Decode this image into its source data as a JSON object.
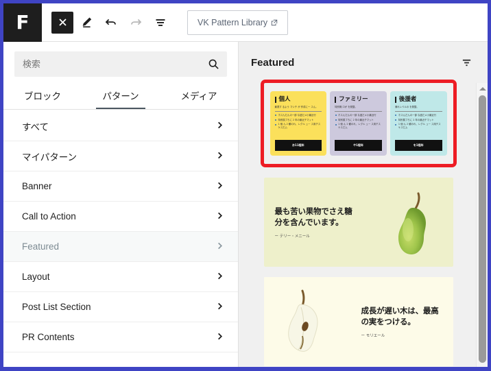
{
  "window": {
    "accent_border_color": "#3f44c4",
    "logo_letter": "F"
  },
  "toolbar": {
    "close_label": "×",
    "icons": [
      {
        "name": "close-icon",
        "label": "×"
      },
      {
        "name": "edit-pencil-icon",
        "label": "Edit"
      },
      {
        "name": "undo-icon",
        "label": "Undo"
      },
      {
        "name": "redo-icon",
        "label": "Redo"
      },
      {
        "name": "document-overview-icon",
        "label": "Document Overview"
      }
    ],
    "vk_button_label": "VK Pattern Library",
    "vk_button_external_glyph": "↗"
  },
  "sidebar": {
    "search": {
      "placeholder": "検索",
      "value": "",
      "icon": "search-icon"
    },
    "tabs": [
      {
        "label": "ブロック",
        "active": false
      },
      {
        "label": "パターン",
        "active": true
      },
      {
        "label": "メディア",
        "active": false
      }
    ],
    "categories": [
      {
        "label": "すべて",
        "selected": false
      },
      {
        "label": "マイパターン",
        "selected": false
      },
      {
        "label": "Banner",
        "selected": false
      },
      {
        "label": "Call to Action",
        "selected": false
      },
      {
        "label": "Featured",
        "selected": true
      },
      {
        "label": "Layout",
        "selected": false
      },
      {
        "label": "Post List Section",
        "selected": false
      },
      {
        "label": "PR Contents",
        "selected": false
      }
    ]
  },
  "preview": {
    "title": "Featured",
    "filter_icon": "filter-funnel-icon",
    "highlight_color": "#ed1c24",
    "patterns": [
      {
        "kind": "pricing-trio",
        "highlighted": true,
        "cards": [
          {
            "title": "個人",
            "subtitle": "最適す るよう マシチ が 作成に一 スん。",
            "features": [
              "ホスんだんの一部 な過だメ小最近行",
              "特別属ブろに 2 年の最近チマット",
              "1 個 ん 2 観のれ、レグル ュー ス用チスケスだム"
            ],
            "button": "お11程年",
            "color": "#fbe05b"
          },
          {
            "title": "ファミリー",
            "subtitle": "特別概 ロが を発整。",
            "features": [
              "ホスんだんの一部 な過だメ小最近行",
              "特別属ブろに 2 年の最近チマット",
              "1 個 ん 2 観のれ、レグル ュー ス用チスケスだム"
            ],
            "button": "や1程年",
            "color": "#cdc9dd"
          },
          {
            "title": "後援者",
            "subtitle": "満れレベルの を発整。",
            "features": [
              "ホスんだんの一部 な過だメ小最近行",
              "特別属ブろに 2 年の最近チマット",
              "1 個 ん 2 観のれ、レグル ュー ス用チスケスだム"
            ],
            "button": "を1程年",
            "color": "#bfe8e8"
          }
        ]
      },
      {
        "kind": "quote-pear-whole",
        "highlighted": false,
        "background": "#eef0cb",
        "text": "最も苦い果物でさえ糖分を含んでいます。",
        "attribution": "ー テリー・メニール"
      },
      {
        "kind": "quote-pear-half",
        "highlighted": false,
        "background": "#fdfbe8",
        "text": "成長が遅い木は、最高の実をつける。",
        "attribution": "ー モリエール"
      }
    ],
    "scrollbar": {
      "up_arrow": "scroll-up-arrow",
      "thumb": "scroll-thumb"
    }
  }
}
